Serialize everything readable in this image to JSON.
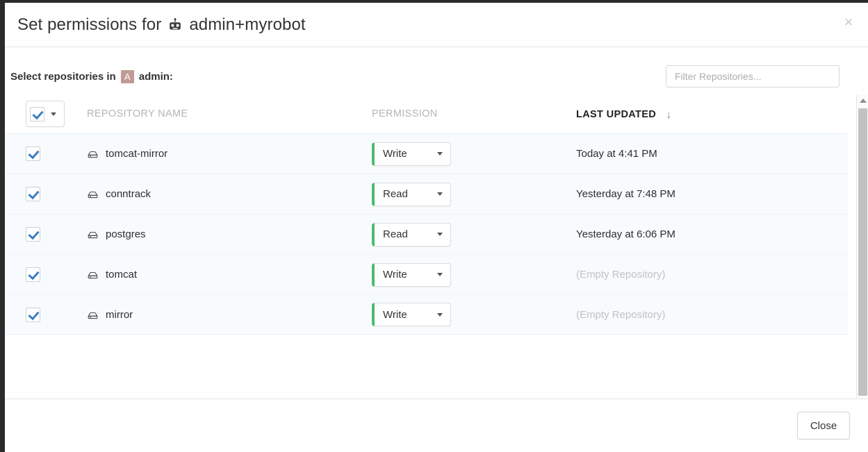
{
  "header": {
    "title_prefix": "Set permissions for",
    "entity_name": "admin+myrobot",
    "robot_icon": "robot-icon",
    "close_label": "×"
  },
  "body": {
    "select_label_prefix": "Select repositories in",
    "org_avatar_letter": "A",
    "org_name": "admin:",
    "filter": {
      "placeholder": "Filter Repositories...",
      "value": ""
    }
  },
  "table": {
    "columns": {
      "repository_name": "REPOSITORY NAME",
      "permission": "PERMISSION",
      "last_updated": "LAST UPDATED"
    },
    "sort_indicator": "↓",
    "select_all_checked": true,
    "rows": [
      {
        "checked": true,
        "repo_icon": "repository-icon",
        "name": "tomcat-mirror",
        "permission": "Write",
        "permission_color": "#4cbb6c",
        "last_updated": "Today at 4:41 PM",
        "empty": false
      },
      {
        "checked": true,
        "repo_icon": "repository-icon",
        "name": "conntrack",
        "permission": "Read",
        "permission_color": "#4cbb6c",
        "last_updated": "Yesterday at 7:48 PM",
        "empty": false
      },
      {
        "checked": true,
        "repo_icon": "repository-icon",
        "name": "postgres",
        "permission": "Read",
        "permission_color": "#4cbb6c",
        "last_updated": "Yesterday at 6:06 PM",
        "empty": false
      },
      {
        "checked": true,
        "repo_icon": "repository-icon",
        "name": "tomcat",
        "permission": "Write",
        "permission_color": "#4cbb6c",
        "last_updated": "(Empty Repository)",
        "empty": true
      },
      {
        "checked": true,
        "repo_icon": "repository-icon",
        "name": "mirror",
        "permission": "Write",
        "permission_color": "#4cbb6c",
        "last_updated": "(Empty Repository)",
        "empty": true
      }
    ]
  },
  "footer": {
    "close_label": "Close"
  },
  "colors": {
    "accent_blue": "#3b7cc4",
    "permission_green": "#4cbb6c",
    "avatar_mauve": "#c29a95",
    "row_background": "#f7fbfd"
  }
}
